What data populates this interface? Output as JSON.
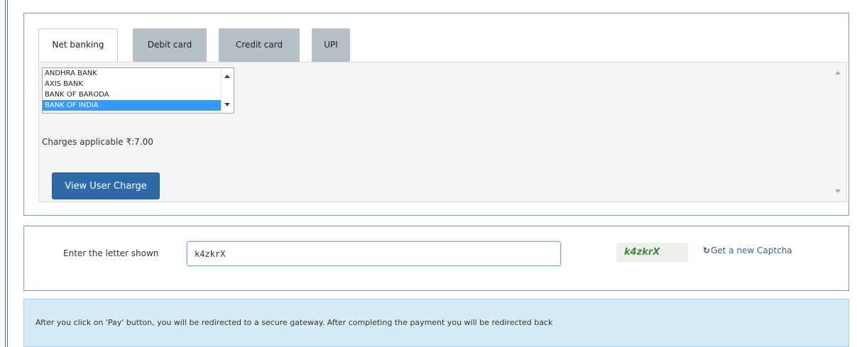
{
  "tabs": [
    {
      "label": "Net banking",
      "active": true
    },
    {
      "label": "Debit card",
      "active": false
    },
    {
      "label": "Credit card",
      "active": false
    },
    {
      "label": "UPI",
      "active": false
    }
  ],
  "bank_list": {
    "items": [
      "ANDHRA BANK",
      "AXIS BANK",
      "BANK OF BARODA",
      "BANK OF INDIA"
    ],
    "selected": "BANK OF INDIA"
  },
  "charges_text": "Charges applicable ₹:7.00",
  "view_user_charge_label": "View User Charge",
  "captcha": {
    "label": "Enter the letter shown",
    "input_value": "k4zkrX",
    "image_text": "k4zkrX",
    "refresh_label": "Get a new Captcha"
  },
  "alert_text": "After you click on 'Pay' button, you will be redirected to a secure gateway. After completing the payment you will be redirected back",
  "colors": {
    "accent": "#2d6aa7",
    "selected": "#3399ff",
    "inactive_tab": "#b5bfc6",
    "alert_bg": "#d6ebf6"
  },
  "icons": {
    "refresh": "refresh-icon",
    "scroll_up": "chevron-up-icon",
    "scroll_down": "chevron-down-icon"
  }
}
